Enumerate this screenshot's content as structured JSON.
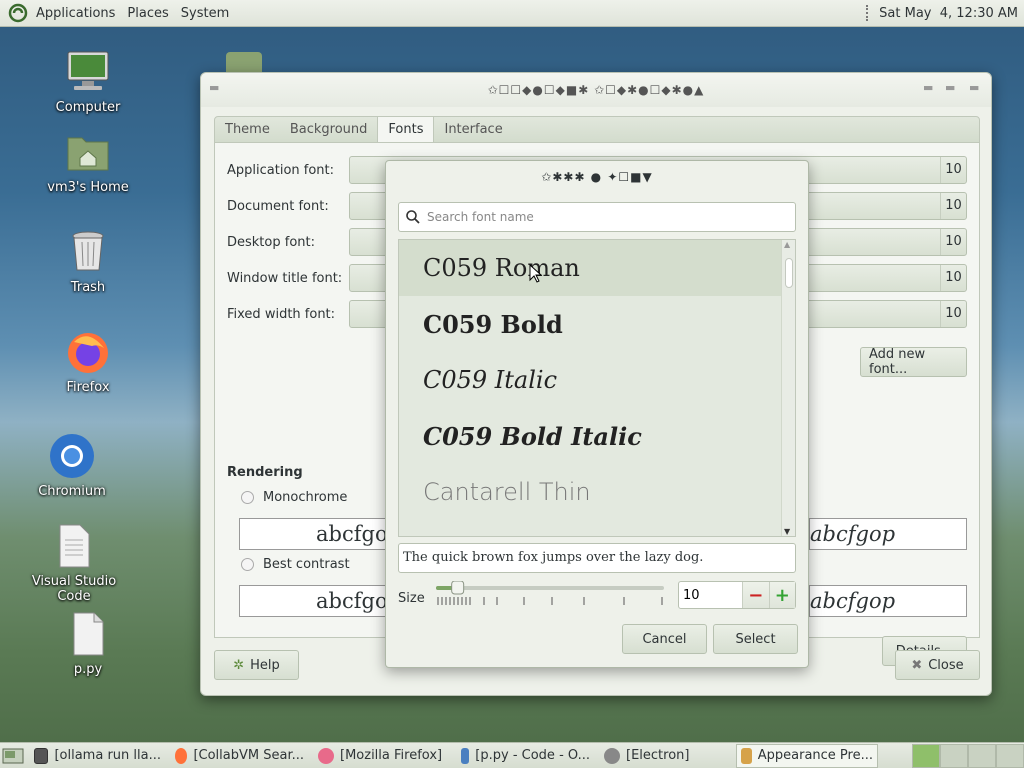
{
  "top_panel": {
    "menus": [
      "Applications",
      "Places",
      "System"
    ],
    "clock": "Sat May  4, 12:30 AM"
  },
  "desktop_icons": [
    {
      "label": "Computer",
      "icon": "computer-icon"
    },
    {
      "label": "vm3's Home",
      "icon": "home-folder-icon"
    },
    {
      "label": "Trash",
      "icon": "trash-icon"
    },
    {
      "label": "Firefox",
      "icon": "firefox-icon"
    },
    {
      "label": "Chromium",
      "icon": "chromium-icon"
    },
    {
      "label": "Visual Studio Code",
      "icon": "document-icon"
    },
    {
      "label": "p.py",
      "icon": "file-icon"
    }
  ],
  "appearance": {
    "title": "✩☐☐◆●☐◆■✱ ✩☐◆✱●☐◆✱●▲",
    "tabs": [
      "Theme",
      "Background",
      "Fonts",
      "Interface"
    ],
    "active_tab": "Fonts",
    "font_rows": [
      {
        "label": "Application font:",
        "size": "10"
      },
      {
        "label": "Document font:",
        "size": "10"
      },
      {
        "label": "Desktop font:",
        "size": "10"
      },
      {
        "label": "Window title font:",
        "size": "10"
      },
      {
        "label": "Fixed width font:",
        "size": "10"
      }
    ],
    "add_font_label": "Add new font...",
    "rendering_label": "Rendering",
    "monochrome_label": "Monochrome",
    "best_contrast_label": "Best contrast",
    "sample_text": "abcfgop",
    "details_label": "Details...",
    "help_label": "Help",
    "close_label": "Close"
  },
  "font_dialog": {
    "title": "✩✱✱✱ ● ✦☐■▼",
    "search_placeholder": "Search font name",
    "fonts": [
      {
        "name": "C059 Roman",
        "style": "roman"
      },
      {
        "name": "C059 Bold",
        "style": "bold"
      },
      {
        "name": "C059 Italic",
        "style": "italic"
      },
      {
        "name": "C059 Bold Italic",
        "style": "bold-italic"
      },
      {
        "name": "Cantarell Thin",
        "style": "thin"
      }
    ],
    "preview_text": "The quick brown fox jumps over the lazy dog.",
    "size_label": "Size",
    "size_value": "10",
    "size_fraction": 0.06,
    "cancel_label": "Cancel",
    "select_label": "Select"
  },
  "taskbar": {
    "tasks": [
      {
        "label": "[ollama run lla...",
        "icon": "terminal-icon"
      },
      {
        "label": "[CollabVM Sear...",
        "icon": "firefox-icon"
      },
      {
        "label": "[Mozilla Firefox]",
        "icon": "firefox-icon"
      },
      {
        "label": "[p.py - Code - O...",
        "icon": "code-icon"
      },
      {
        "label": "[Electron]",
        "icon": "electron-icon"
      },
      {
        "label": "Appearance Pre...",
        "icon": "appearance-icon"
      }
    ]
  }
}
